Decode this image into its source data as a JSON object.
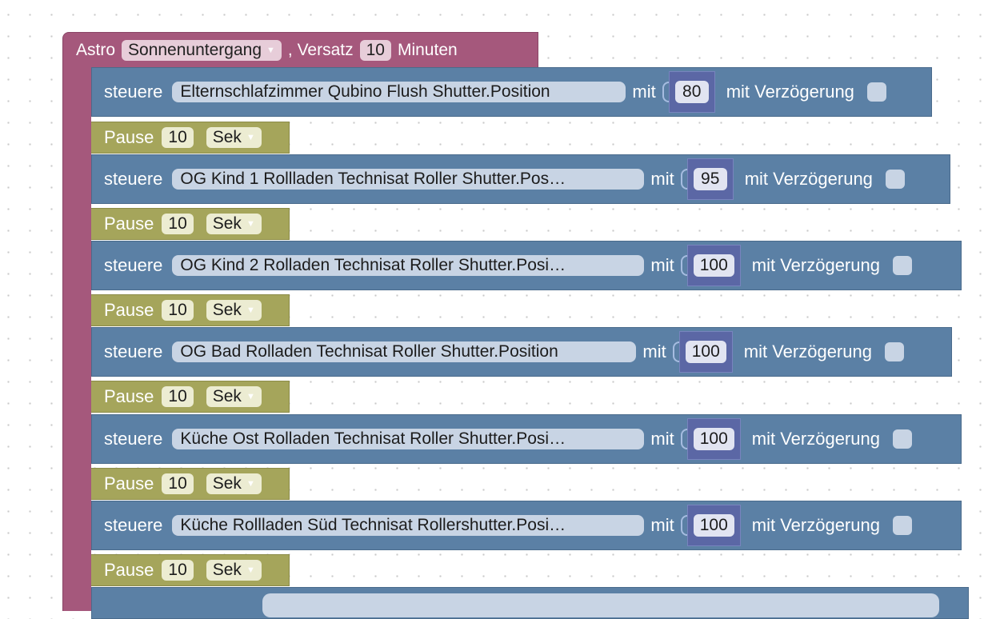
{
  "astro": {
    "label": "Astro",
    "event": "Sonnenuntergang",
    "offset_label": ", Versatz",
    "offset_value": "10",
    "offset_unit": "Minuten"
  },
  "controls": [
    {
      "verb": "steuere",
      "object": "Elternschlafzimmer Qubino Flush Shutter.Position",
      "with_label": "mit",
      "value": "80",
      "delay_label": "mit Verzögerung"
    },
    {
      "verb": "steuere",
      "object": "OG Kind 1 Rollladen Technisat Roller Shutter.Pos…",
      "with_label": "mit",
      "value": "95",
      "delay_label": "mit Verzögerung"
    },
    {
      "verb": "steuere",
      "object": "OG Kind 2 Rolladen Technisat Roller Shutter.Posi…",
      "with_label": "mit",
      "value": "100",
      "delay_label": "mit Verzögerung"
    },
    {
      "verb": "steuere",
      "object": "OG Bad Rolladen Technisat Roller Shutter.Position",
      "with_label": "mit",
      "value": "100",
      "delay_label": "mit Verzögerung"
    },
    {
      "verb": "steuere",
      "object": "Küche Ost Rolladen Technisat Roller Shutter.Posi…",
      "with_label": "mit",
      "value": "100",
      "delay_label": "mit Verzögerung"
    },
    {
      "verb": "steuere",
      "object": "Küche Rollladen Süd Technisat Rollershutter.Posi…",
      "with_label": "mit",
      "value": "100",
      "delay_label": "mit Verzögerung"
    }
  ],
  "pauses": [
    {
      "label": "Pause",
      "value": "10",
      "unit": "Sek"
    },
    {
      "label": "Pause",
      "value": "10",
      "unit": "Sek"
    },
    {
      "label": "Pause",
      "value": "10",
      "unit": "Sek"
    },
    {
      "label": "Pause",
      "value": "10",
      "unit": "Sek"
    },
    {
      "label": "Pause",
      "value": "10",
      "unit": "Sek"
    },
    {
      "label": "Pause",
      "value": "10",
      "unit": "Sek"
    }
  ],
  "colors": {
    "astro": "#a5587c",
    "control": "#5b80a5",
    "value": "#5b67a5",
    "pause": "#a5a55b"
  }
}
